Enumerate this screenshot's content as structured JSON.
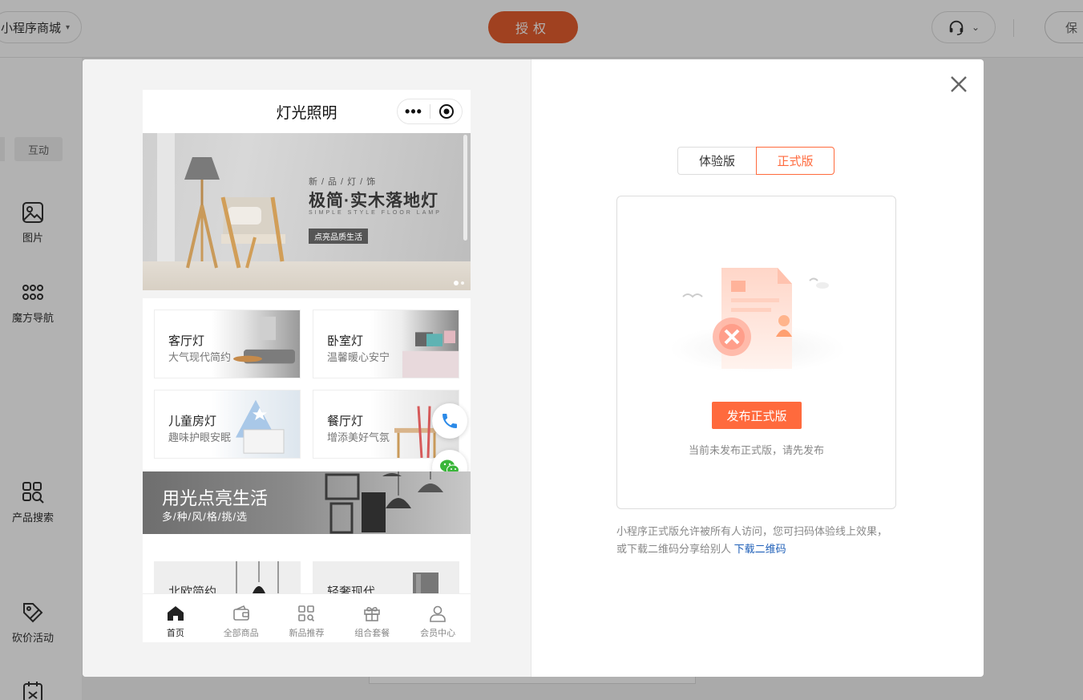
{
  "topbar": {
    "store_select": "小程序商城",
    "auth_button": "授权",
    "save_button": "保"
  },
  "sidebar": {
    "tab_interact": "互动",
    "items": [
      {
        "label": "图片",
        "icon": "image-icon"
      },
      {
        "label": "魔方导航",
        "icon": "grid-dots-icon"
      },
      {
        "label": "产品搜索",
        "icon": "product-search-icon"
      },
      {
        "label": "砍价活动",
        "icon": "bargain-tag-icon"
      }
    ]
  },
  "phone": {
    "title": "灯光照明",
    "banner": {
      "sub": "新/品/灯/饰",
      "title": "极简·实木落地灯",
      "en": "SIMPLE STYLE FLOOR LAMP",
      "tag": "点亮品质生活"
    },
    "categories": [
      {
        "name": "客厅灯",
        "desc": "大气现代简约"
      },
      {
        "name": "卧室灯",
        "desc": "温馨暖心安宁"
      },
      {
        "name": "儿童房灯",
        "desc": "趣味护眼安眠"
      },
      {
        "name": "餐厅灯",
        "desc": "增添美好气氛"
      }
    ],
    "promo": {
      "title": "用光点亮生活",
      "sub": "多/种/风/格/挑/选"
    },
    "products": [
      {
        "name": "北欧简约"
      },
      {
        "name": "轻奢现代"
      }
    ],
    "tabbar": [
      {
        "label": "首页",
        "icon": "home-icon",
        "active": true
      },
      {
        "label": "全部商品",
        "icon": "wallet-icon",
        "active": false
      },
      {
        "label": "新品推荐",
        "icon": "new-grid-icon",
        "active": false
      },
      {
        "label": "组合套餐",
        "icon": "gift-icon",
        "active": false
      },
      {
        "label": "会员中心",
        "icon": "user-icon",
        "active": false
      }
    ]
  },
  "publish": {
    "tab_trial": "体验版",
    "tab_official": "正式版",
    "button": "发布正式版",
    "hint": "当前未发布正式版，请先发布",
    "description": "小程序正式版允许被所有人访问，您可扫码体验线上效果，或下载二维码分享给别人",
    "download_link": "下载二维码"
  },
  "colors": {
    "accent": "#ff6a3d",
    "auth_button": "#e65d2e",
    "link": "#1e5fb8"
  }
}
